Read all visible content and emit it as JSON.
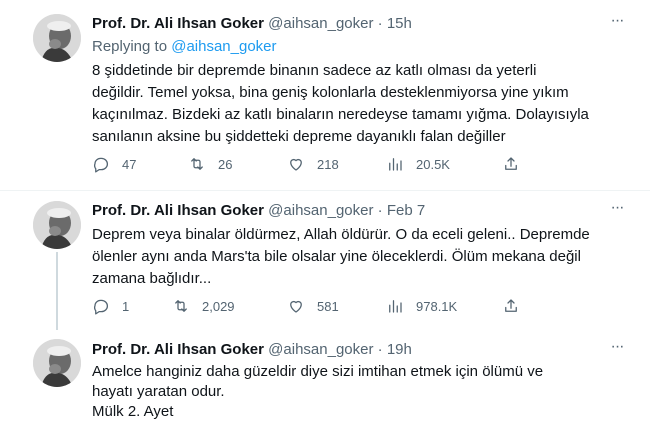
{
  "tweets": [
    {
      "name": "Prof. Dr. Ali Ihsan Goker",
      "handle": "@aihsan_goker",
      "separator": "·",
      "time": "15h",
      "more": "···",
      "replying_prefix": "Replying to",
      "replying_to": "@aihsan_goker",
      "lines": [
        "8 şiddetinde bir depremde binanın sadece az katlı olması da yeterli",
        "değildir. Temel yoksa, bina geniş kolonlarla desteklenmiyorsa yine yıkım",
        "kaçınılmaz. Bizdeki az katlı binaların neredeyse tamamı yığma. Dolayısıyla",
        "sanılanın aksine bu şiddetteki depreme dayanıklı falan değiller"
      ],
      "replies": "47",
      "retweets": "26",
      "likes": "218",
      "views": "20.5K"
    },
    {
      "name": "Prof. Dr. Ali Ihsan Goker",
      "handle": "@aihsan_goker",
      "separator": "·",
      "time": "Feb 7",
      "more": "···",
      "lines": [
        "Deprem veya binalar öldürmez, Allah öldürür. O da eceli geleni.. Depremde",
        "ölenler aynı anda Mars'ta bile olsalar yine öleceklerdi. Ölüm mekana değil",
        "zamana bağlıdır..."
      ],
      "replies": "1",
      "retweets": "2,029",
      "likes": "581",
      "views": "978.1K"
    },
    {
      "name": "Prof. Dr. Ali Ihsan Goker",
      "handle": "@aihsan_goker",
      "separator": "·",
      "time": "19h",
      "more": "···",
      "lines": [
        "Amelce hanginiz daha güzeldir diye sizi imtihan etmek için ölümü ve",
        "hayatı yaratan odur.",
        "Mülk 2. Ayet"
      ]
    }
  ]
}
